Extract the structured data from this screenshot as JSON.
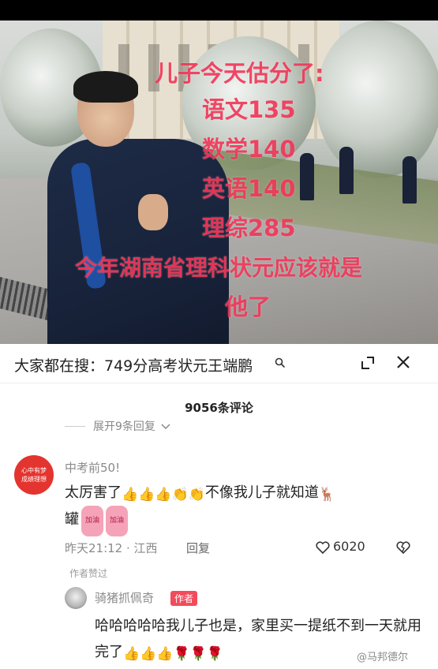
{
  "photo_overlay": {
    "line1": "儿子今天估分了:",
    "line2": "语文135",
    "line3": "数学140",
    "line4": "英语140",
    "line5": "理综285",
    "line6": "今年湖南省理科状元应该就是",
    "line7": "他了"
  },
  "search": {
    "text": "大家都在搜：749分高考状元王端鹏",
    "search_icon": "search-icon",
    "minimize_icon": "minimize-icon",
    "close_icon": "close-icon"
  },
  "comments_header": {
    "count_label": "9056条评论",
    "expand_label": "展开9条回复"
  },
  "comment1": {
    "avatar_text1": "心中有梦",
    "avatar_text2": "成绩理想",
    "username": "中考前50!",
    "text_a": "太厉害了",
    "emoji_thumbs": "👍👍👍",
    "emoji_clap": "👏👏",
    "text_b": "不像我儿子就知道",
    "emoji_deer": "🦌",
    "text_c": "罐",
    "chip1": "加油",
    "chip2": "加油",
    "time": "昨天21:12 · 江西",
    "reply_label": "回复",
    "likes": "6020",
    "author_liked": "作者赞过"
  },
  "comment2": {
    "username": "骑猪抓佩奇",
    "badge": "作者",
    "text": "哈哈哈哈哈我儿子也是，家里买一提纸不到一天就用完了",
    "emoji_thumbs": "👍👍👍",
    "emoji_rose": "🌹🌹🌹"
  },
  "watermark": "@马邦德尔",
  "colors": {
    "overlay_text": "#f2385a",
    "author_badge": "#f24b5c",
    "avatar_red": "#e3342f"
  }
}
